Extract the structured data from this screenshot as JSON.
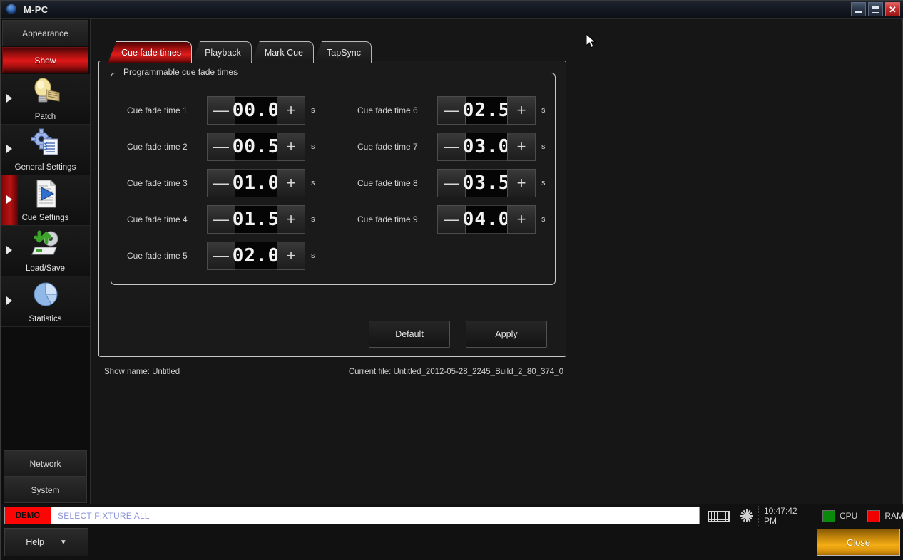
{
  "window": {
    "title": "M-PC",
    "icon": "app-sphere-icon",
    "controls": {
      "minimize": "_",
      "maximize": "□",
      "close": "✕"
    }
  },
  "sidebar": {
    "top_buttons": [
      {
        "label": "Appearance",
        "active": false
      },
      {
        "label": "Show",
        "active": true
      }
    ],
    "nav_items": [
      {
        "label": "Patch",
        "icon": "lightbulb-patch-icon",
        "selected": false
      },
      {
        "label": "General Settings",
        "icon": "gear-list-icon",
        "selected": false
      },
      {
        "label": "Cue Settings",
        "icon": "document-play-icon",
        "selected": true
      },
      {
        "label": "Load/Save",
        "icon": "disk-arrows-icon",
        "selected": false
      },
      {
        "label": "Statistics",
        "icon": "pie-chart-icon",
        "selected": false
      }
    ],
    "bottom_buttons": [
      {
        "label": "Network"
      },
      {
        "label": "System"
      }
    ]
  },
  "tabs": [
    {
      "label": "Cue fade times",
      "active": true
    },
    {
      "label": "Playback",
      "active": false
    },
    {
      "label": "Mark Cue",
      "active": false
    },
    {
      "label": "TapSync",
      "active": false
    }
  ],
  "groupbox": {
    "title": "Programmable cue fade times",
    "unit": "s",
    "decrement_label": "—",
    "increment_label": "+",
    "left_column": [
      {
        "label": "Cue fade time 1",
        "value": "00.0"
      },
      {
        "label": "Cue fade time 2",
        "value": "00.5"
      },
      {
        "label": "Cue fade time 3",
        "value": "01.0"
      },
      {
        "label": "Cue fade time 4",
        "value": "01.5"
      },
      {
        "label": "Cue fade time 5",
        "value": "02.0"
      }
    ],
    "right_column": [
      {
        "label": "Cue fade time 6",
        "value": "02.5"
      },
      {
        "label": "Cue fade time 7",
        "value": "03.0"
      },
      {
        "label": "Cue fade time 8",
        "value": "03.5"
      },
      {
        "label": "Cue fade time 9",
        "value": "04.0"
      }
    ]
  },
  "actions": {
    "default_label": "Default",
    "apply_label": "Apply"
  },
  "infoline": {
    "show_name": "Show name: Untitled",
    "current_file": "Current file: Untitled_2012-05-28_2245_Build_2_80_374_0"
  },
  "commandbar": {
    "badge": "DEMO",
    "text": "SELECT FIXTURE ALL"
  },
  "statusbar": {
    "keyboard_icon": "keyboard-icon",
    "brightness_icon": "sun-icon",
    "time": "10:47:42 PM",
    "cpu_label": "CPU",
    "ram_label": "RAM",
    "cpu_color": "#0a8a0a",
    "ram_color": "#f20000"
  },
  "footer": {
    "help_label": "Help",
    "help_caret": "▼",
    "close_label": "Close"
  },
  "colors": {
    "accent_red": "#e21b1b",
    "accent_orange": "#f5ad15",
    "panel_bg": "#1a1a1a",
    "border": "#c8c8c8"
  }
}
